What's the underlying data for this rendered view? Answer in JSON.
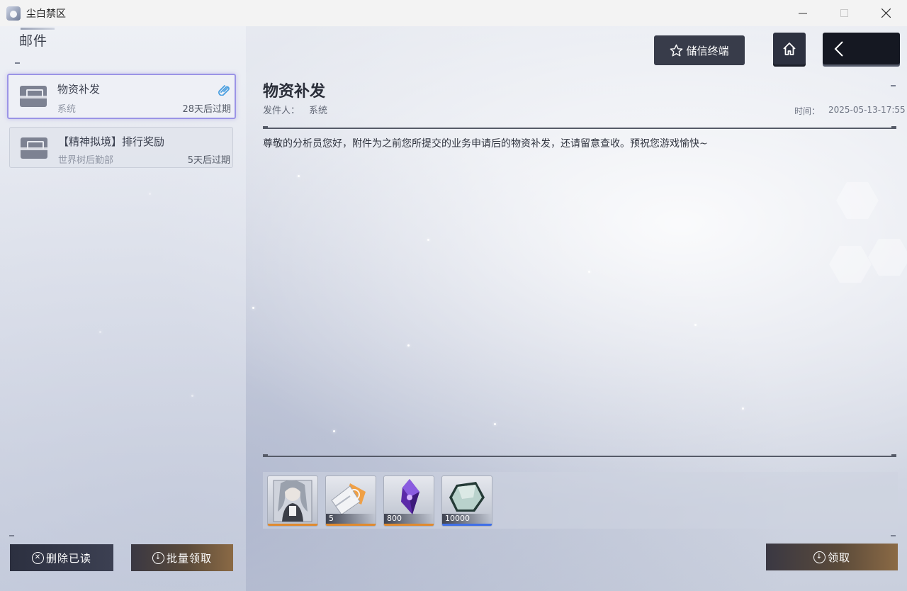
{
  "window": {
    "title": "尘白禁区",
    "minimize_icon": "minimize-icon",
    "maximize_icon": "maximize-icon",
    "close_icon": "close-icon"
  },
  "sidebar": {
    "header": "邮件",
    "mails": [
      {
        "title": "物资补发",
        "sender": "系统",
        "expire": "28天后过期",
        "has_attachment": true,
        "selected": true
      },
      {
        "title": "【精神拟境】排行奖励",
        "sender": "世界树后勤部",
        "expire": "5天后过期",
        "has_attachment": false,
        "selected": false
      }
    ],
    "delete_read_label": "删除已读",
    "batch_claim_label": "批量领取"
  },
  "topbar": {
    "terminal_label": "储信终端",
    "home_icon": "home-icon",
    "back_icon": "back-arrow-icon"
  },
  "detail": {
    "title": "物资补发",
    "sender_label": "发件人：",
    "sender": "系统",
    "time_label": "时间：",
    "time": "2025-05-13-17:55",
    "body": "尊敬的分析员您好，附件为之前您所提交的业务申请后的物资补发，还请留意查收。预祝您游戏愉快~",
    "attachments": [
      {
        "name": "character-card",
        "count": "",
        "rarity_color": "#e08a2e"
      },
      {
        "name": "ticket-item",
        "count": "5",
        "rarity_color": "#e08a2e"
      },
      {
        "name": "purple-crystal",
        "count": "800",
        "rarity_color": "#e08a2e"
      },
      {
        "name": "hexagon-gem",
        "count": "10000",
        "rarity_color": "#3f6fe8"
      }
    ],
    "claim_label": "领取"
  },
  "colors": {
    "selected_border": "#9b94e6",
    "dark_button": "#2c3040",
    "gold_button": "#8b6a45"
  }
}
